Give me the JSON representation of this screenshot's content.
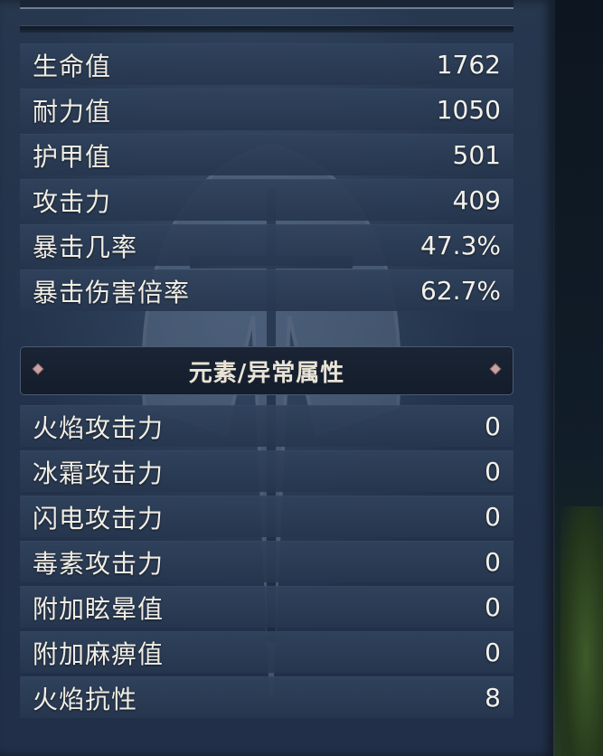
{
  "main_stats": [
    {
      "label": "生命值",
      "value": "1762"
    },
    {
      "label": "耐力值",
      "value": "1050"
    },
    {
      "label": "护甲值",
      "value": "501"
    },
    {
      "label": "攻击力",
      "value": "409"
    },
    {
      "label": "暴击几率",
      "value": "47.3%"
    },
    {
      "label": "暴击伤害倍率",
      "value": "62.7%"
    }
  ],
  "element_section": {
    "title": "元素/异常属性"
  },
  "element_stats": [
    {
      "label": "火焰攻击力",
      "value": "0"
    },
    {
      "label": "冰霜攻击力",
      "value": "0"
    },
    {
      "label": "闪电攻击力",
      "value": "0"
    },
    {
      "label": "毒素攻击力",
      "value": "0"
    },
    {
      "label": "附加眩晕值",
      "value": "0"
    },
    {
      "label": "附加麻痹值",
      "value": "0"
    },
    {
      "label": "火焰抗性",
      "value": "8"
    }
  ],
  "colors": {
    "panel_bg": "#22324a",
    "row_bg": "#30425c",
    "text": "#f0ede4",
    "ornament": "#c9a3a3"
  },
  "icons": {
    "ornament": "diamond-ornament-icon",
    "emblem": "helmet-emblem-icon"
  }
}
